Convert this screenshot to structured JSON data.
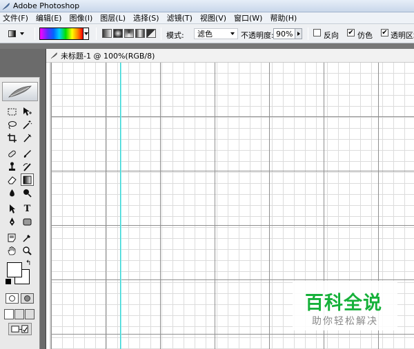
{
  "app": {
    "title": "Adobe Photoshop"
  },
  "menu": {
    "items": [
      "文件(F)",
      "编辑(E)",
      "图像(I)",
      "图层(L)",
      "选择(S)",
      "滤镜(T)",
      "视图(V)",
      "窗口(W)",
      "帮助(H)"
    ]
  },
  "options": {
    "mode_label": "模式:",
    "mode_value": "滤色",
    "opacity_label": "不透明度:",
    "opacity_value": "90%",
    "reverse_label": "反向",
    "reverse_checked": false,
    "dither_label": "仿色",
    "dither_checked": true,
    "transparency_label": "透明区域",
    "transparency_checked": true,
    "gradient_colors": [
      "#ff00ff",
      "#0066ff",
      "#00d0ff",
      "#00e000",
      "#ffff00",
      "#ff8800",
      "#ff0000"
    ]
  },
  "document": {
    "title": "未标题-1 @ 100%(RGB/8)",
    "guide_color": "#33d6d6",
    "grid_major_color": "#8e8e8e",
    "grid_minor_color": "#dcdcdc"
  },
  "toolbox": {
    "text_tool_glyph": "T",
    "foreground_color": "#ffffff",
    "background_color": "#ffffff"
  },
  "watermark": {
    "title": "百科全说",
    "subtitle": "助你轻松解决",
    "color": "#16b13a"
  }
}
